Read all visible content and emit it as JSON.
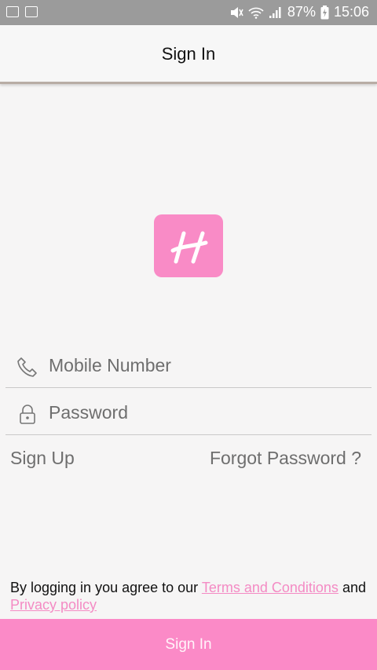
{
  "status": {
    "battery": "87%",
    "time": "15:06"
  },
  "header": {
    "title": "Sign In"
  },
  "form": {
    "mobile_placeholder": "Mobile Number",
    "password_placeholder": "Password"
  },
  "links": {
    "sign_up": "Sign Up",
    "forgot": "Forgot Password ?"
  },
  "terms": {
    "prefix": "By logging in you agree to our ",
    "terms_link": "Terms and Conditions",
    "and": " and",
    "privacy_link": "Privacy policy"
  },
  "button": {
    "label": "Sign In"
  },
  "colors": {
    "accent": "#f98bc6",
    "statusbar": "#9b9b9b"
  }
}
